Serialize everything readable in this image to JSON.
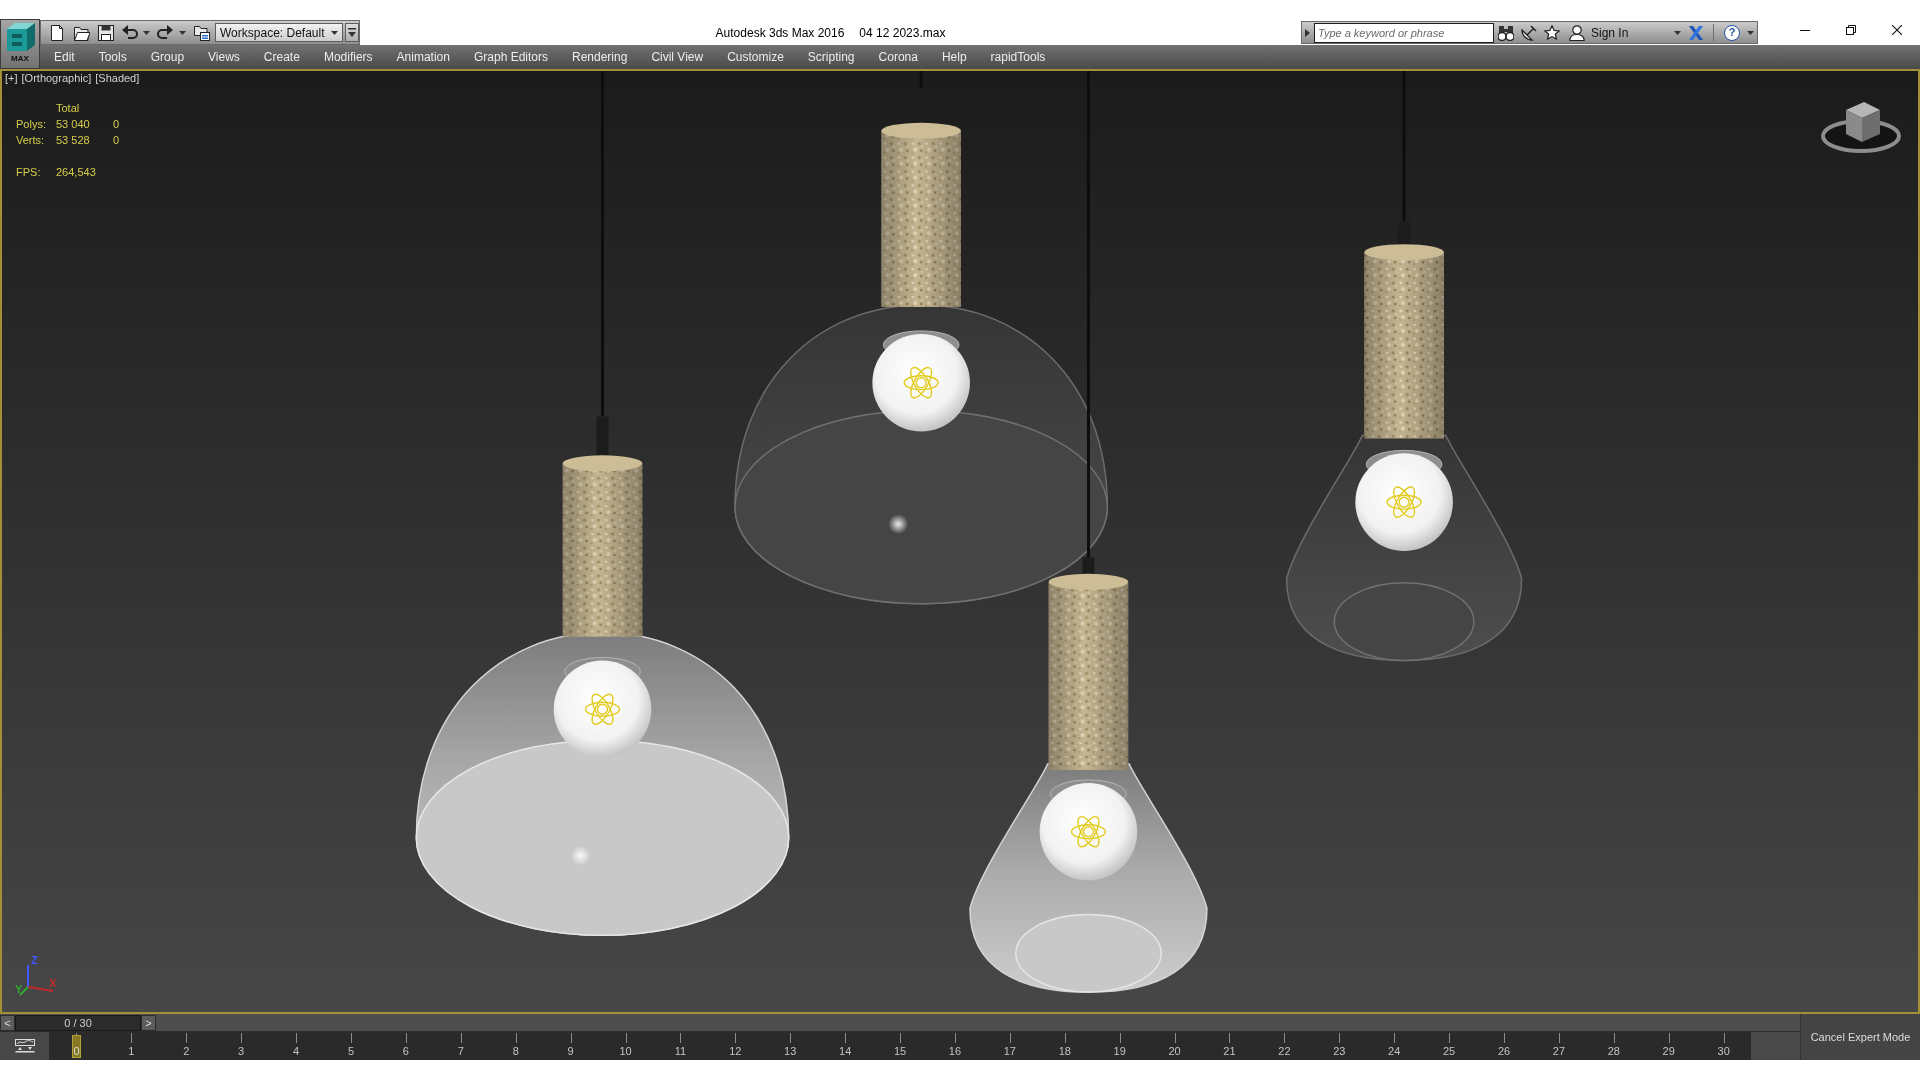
{
  "title_bar": {
    "app_button": {
      "label": "MAX"
    },
    "workspace": "Workspace: Default",
    "title": "Autodesk 3ds Max 2016",
    "file_name": "04 12 2023.max",
    "search": {
      "placeholder": "Type a keyword or phrase"
    },
    "sign_in": "Sign In",
    "help": "?"
  },
  "menu_bar": {
    "items": [
      "Edit",
      "Tools",
      "Group",
      "Views",
      "Create",
      "Modifiers",
      "Animation",
      "Graph Editors",
      "Rendering",
      "Civil View",
      "Customize",
      "Scripting",
      "Corona",
      "Help",
      "rapidTools"
    ]
  },
  "viewport": {
    "active": true,
    "labels": [
      "[+]",
      "[Orthographic]",
      "[Shaded]"
    ],
    "stats": {
      "header": "Total",
      "rows": [
        {
          "label": "Polys:",
          "total": "53 040",
          "column_3": "0"
        },
        {
          "label": "Verts:",
          "total": "53 528",
          "column_3": "0"
        }
      ],
      "fps": {
        "label": "FPS:",
        "value": "264,543"
      }
    },
    "axes": [
      {
        "label": "Z",
        "color": "#4058ff"
      },
      {
        "label": "X",
        "color": "#c42828"
      },
      {
        "label": "Y",
        "color": "#2eac30"
      }
    ]
  },
  "time_slider": {
    "previous": "<",
    "position": "0 / 30",
    "next": ">",
    "level": 0
  },
  "track_bar": {
    "frames": [
      {
        "label": "0",
        "selected": true
      },
      {
        "label": "1",
        "selected": false
      },
      {
        "label": "2",
        "selected": false
      },
      {
        "label": "3",
        "selected": false
      },
      {
        "label": "4",
        "selected": false
      },
      {
        "label": "5",
        "selected": false
      },
      {
        "label": "6",
        "selected": false
      },
      {
        "label": "7",
        "selected": false
      },
      {
        "label": "8",
        "selected": false
      },
      {
        "label": "9",
        "selected": false
      },
      {
        "label": "10",
        "selected": false
      },
      {
        "label": "11",
        "selected": false
      },
      {
        "label": "12",
        "selected": false
      },
      {
        "label": "13",
        "selected": false
      },
      {
        "label": "14",
        "selected": false
      },
      {
        "label": "15",
        "selected": false
      },
      {
        "label": "16",
        "selected": false
      },
      {
        "label": "17",
        "selected": false
      },
      {
        "label": "18",
        "selected": false
      },
      {
        "label": "19",
        "selected": false
      },
      {
        "label": "20",
        "selected": false
      },
      {
        "label": "21",
        "selected": false
      },
      {
        "label": "22",
        "selected": false
      },
      {
        "label": "23",
        "selected": false
      },
      {
        "label": "24",
        "selected": false
      },
      {
        "label": "25",
        "selected": false
      },
      {
        "label": "26",
        "selected": false
      },
      {
        "label": "27",
        "selected": false
      },
      {
        "label": "28",
        "selected": false
      },
      {
        "label": "29",
        "selected": false
      },
      {
        "label": "30",
        "selected": false
      }
    ]
  },
  "expert_mode_button": "Cancel Expert Mode"
}
